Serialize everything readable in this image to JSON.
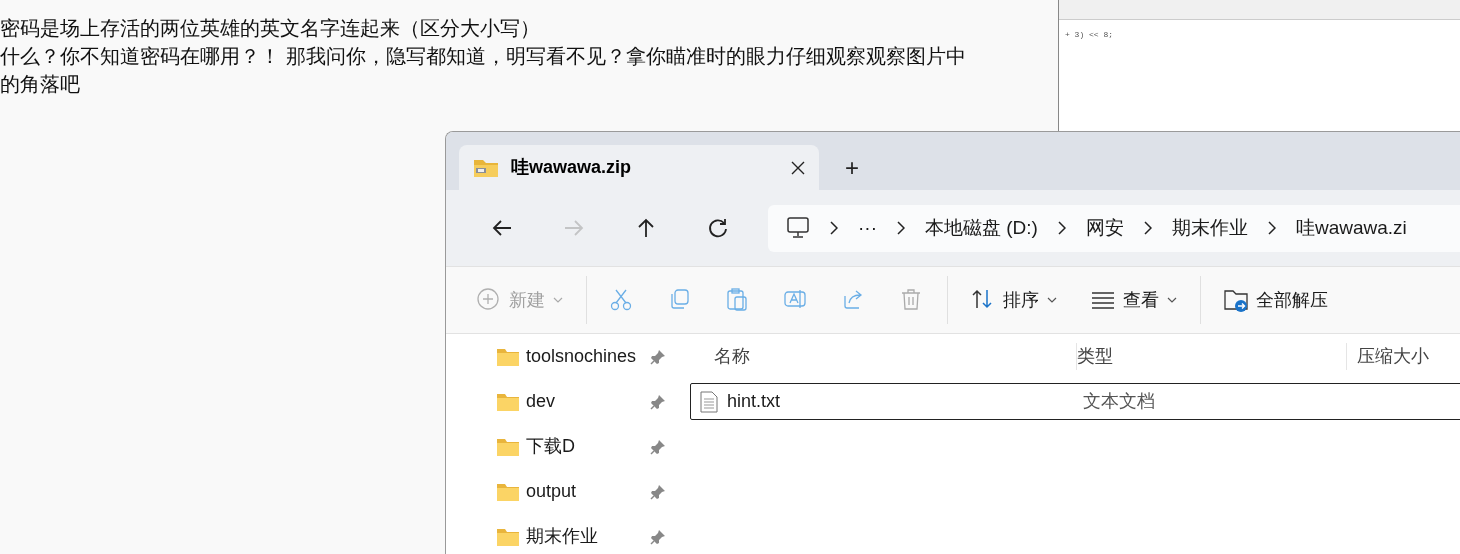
{
  "background_text": {
    "lines": [
      "密码是场上存活的两位英雄的英文名字连起来（区分大小写）",
      "什么？你不知道密码在哪用？！ 那我问你，隐写都知道，明写看不见？拿你瞄准时的眼力仔细观察观察图片中",
      "的角落吧"
    ]
  },
  "code_editor": {
    "code_line": "+ 3) << 8;"
  },
  "explorer": {
    "tabs": [
      {
        "label": "哇wawawa.zip",
        "selected": true
      }
    ],
    "new_tab": "+",
    "nav_buttons": [
      {
        "kind": "back",
        "disabled": false
      },
      {
        "kind": "forward",
        "disabled": true
      },
      {
        "kind": "up",
        "disabled": false
      },
      {
        "kind": "refresh",
        "disabled": false
      }
    ],
    "breadcrumb": {
      "overflow": "···",
      "parts": [
        "本地磁盘 (D:)",
        "网安",
        "期末作业",
        "哇wawawa.zi"
      ]
    },
    "toolbar": [
      {
        "kind": "new",
        "label": "新建",
        "disabled": true,
        "dropdown": true
      },
      {
        "kind": "cut",
        "disabled": true
      },
      {
        "kind": "copy",
        "disabled": true
      },
      {
        "kind": "paste",
        "disabled": true
      },
      {
        "kind": "rename",
        "disabled": true
      },
      {
        "kind": "share",
        "disabled": true
      },
      {
        "kind": "delete",
        "disabled": true
      },
      {
        "kind": "sort",
        "label": "排序",
        "disabled": false,
        "dropdown": true
      },
      {
        "kind": "view",
        "label": "查看",
        "disabled": false,
        "dropdown": true
      },
      {
        "kind": "extract",
        "label": "全部解压",
        "disabled": false,
        "dropdown": false
      }
    ],
    "quick_access": [
      {
        "label": "toolsnochines",
        "pinned": true
      },
      {
        "label": "dev",
        "pinned": true
      },
      {
        "label": "下载D",
        "pinned": true
      },
      {
        "label": "output",
        "pinned": true
      },
      {
        "label": "期末作业",
        "pinned": true
      }
    ],
    "columns": [
      "名称",
      "类型",
      "压缩大小"
    ],
    "files": [
      {
        "name": "hint.txt",
        "type": "文本文档",
        "selected": true
      }
    ]
  }
}
